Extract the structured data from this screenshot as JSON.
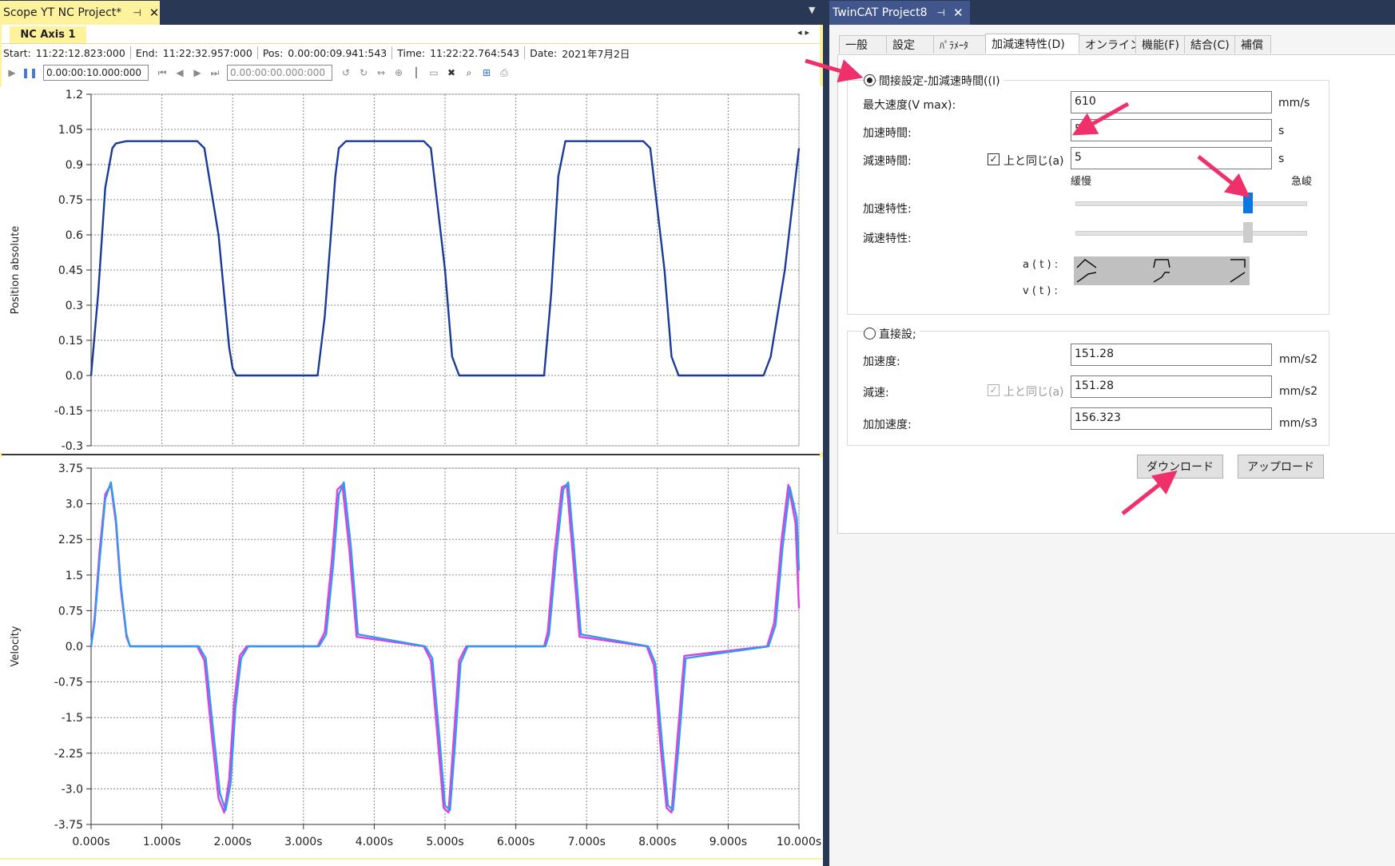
{
  "scope": {
    "tab_title": "Scope YT NC Project*",
    "pin_icon": "pin-icon",
    "close_icon": "close-icon",
    "axis_tab": "NC  Axis 1",
    "info": {
      "start_label": "Start:",
      "start_value": "11:22:12.823:000",
      "end_label": "End:",
      "end_value": "11:22:32.957:000",
      "pos_label": "Pos:",
      "pos_value": "0.00:00:09.941:543",
      "time_label": "Time:",
      "time_value": "11:22:22.764:543",
      "date_label": "Date:",
      "date_value": "2021年7月2日"
    },
    "toolbar": {
      "duration_value": "0.00:00:10.000:000",
      "offset_value": "0.00:00:00.000:000"
    }
  },
  "chart_data": [
    {
      "type": "line",
      "name": "position-chart",
      "ylabel": "Position absolute",
      "xlabel": "",
      "xlim": [
        0,
        10
      ],
      "ylim": [
        -0.3,
        1.2
      ],
      "y_ticks": [
        "1.2",
        "1.05",
        "0.9",
        "0.75",
        "0.6",
        "0.45",
        "0.3",
        "0.15",
        "0.0",
        "-0.15",
        "-0.3"
      ],
      "y_tick_values": [
        1.2,
        1.05,
        0.9,
        0.75,
        0.6,
        0.45,
        0.3,
        0.15,
        0.0,
        -0.15,
        -0.3
      ],
      "grid": true,
      "series": [
        {
          "color": "#1a3a9a",
          "x": [
            0.0,
            0.1,
            0.2,
            0.3,
            0.35,
            0.5,
            1.5,
            1.6,
            1.8,
            1.95,
            2.0,
            2.05,
            2.2,
            3.2,
            3.3,
            3.45,
            3.5,
            3.6,
            4.7,
            4.8,
            5.0,
            5.1,
            5.2,
            6.4,
            6.5,
            6.6,
            6.7,
            7.8,
            7.9,
            8.1,
            8.2,
            8.3,
            9.5,
            9.6,
            9.8,
            10.0
          ],
          "y": [
            0.0,
            0.35,
            0.8,
            0.97,
            0.99,
            1.0,
            1.0,
            0.97,
            0.6,
            0.12,
            0.03,
            0.0,
            0.0,
            0.0,
            0.25,
            0.85,
            0.97,
            1.0,
            1.0,
            0.97,
            0.45,
            0.08,
            0.0,
            0.0,
            0.35,
            0.85,
            1.0,
            1.0,
            0.97,
            0.45,
            0.08,
            0.0,
            0.0,
            0.08,
            0.45,
            0.97
          ]
        }
      ]
    },
    {
      "type": "line",
      "name": "velocity-chart",
      "ylabel": "Velocity",
      "xlabel": "",
      "x_ticks": [
        "0.000s",
        "1.000s",
        "2.000s",
        "3.000s",
        "4.000s",
        "5.000s",
        "6.000s",
        "7.000s",
        "8.000s",
        "9.000s",
        "10.000s"
      ],
      "x_tick_values": [
        0,
        1,
        2,
        3,
        4,
        5,
        6,
        7,
        8,
        9,
        10
      ],
      "xlim": [
        0,
        10
      ],
      "ylim": [
        -3.75,
        3.75
      ],
      "y_ticks": [
        "3.75",
        "3.0",
        "2.25",
        "1.5",
        "0.75",
        "0.0",
        "-0.75",
        "-1.5",
        "-2.25",
        "-3.0",
        "-3.75"
      ],
      "y_tick_values": [
        3.75,
        3.0,
        2.25,
        1.5,
        0.75,
        0.0,
        -0.75,
        -1.5,
        -2.25,
        -3.0,
        -3.75
      ],
      "grid": true,
      "series": [
        {
          "color": "#e040e0",
          "x": [
            0.0,
            0.05,
            0.12,
            0.2,
            0.28,
            0.35,
            0.42,
            0.5,
            0.55,
            1.5,
            1.6,
            1.7,
            1.8,
            1.88,
            1.95,
            2.02,
            2.1,
            2.2,
            3.2,
            3.3,
            3.4,
            3.48,
            3.55,
            3.65,
            3.75,
            4.7,
            4.8,
            4.9,
            4.98,
            5.05,
            5.12,
            5.2,
            5.3,
            6.4,
            6.45,
            6.55,
            6.65,
            6.72,
            6.8,
            6.9,
            7.85,
            7.95,
            8.05,
            8.13,
            8.2,
            8.28,
            8.38,
            9.55,
            9.65,
            9.75,
            9.85,
            9.95,
            10.0
          ],
          "y": [
            0.0,
            0.6,
            2.0,
            3.2,
            3.4,
            2.6,
            1.2,
            0.2,
            0.0,
            0.0,
            -0.3,
            -1.8,
            -3.2,
            -3.5,
            -2.8,
            -1.2,
            -0.2,
            0.0,
            0.0,
            0.3,
            1.8,
            3.3,
            3.4,
            2.0,
            0.2,
            0.0,
            -0.3,
            -2.0,
            -3.4,
            -3.5,
            -2.0,
            -0.3,
            0.0,
            0.0,
            0.3,
            2.0,
            3.35,
            3.4,
            2.0,
            0.2,
            0.0,
            -0.4,
            -2.2,
            -3.4,
            -3.5,
            -2.0,
            -0.2,
            0.0,
            0.5,
            2.2,
            3.4,
            2.6,
            0.8
          ]
        },
        {
          "color": "#3399ee",
          "x": [
            0.0,
            0.05,
            0.12,
            0.2,
            0.28,
            0.35,
            0.42,
            0.5,
            0.55,
            1.52,
            1.62,
            1.72,
            1.82,
            1.9,
            1.97,
            2.04,
            2.12,
            2.22,
            3.22,
            3.32,
            3.42,
            3.5,
            3.57,
            3.67,
            3.77,
            4.72,
            4.82,
            4.92,
            5.0,
            5.07,
            5.14,
            5.22,
            5.32,
            6.42,
            6.47,
            6.57,
            6.67,
            6.74,
            6.82,
            6.92,
            7.87,
            7.97,
            8.07,
            8.15,
            8.22,
            8.3,
            8.4,
            9.57,
            9.67,
            9.77,
            9.87,
            9.97,
            10.0
          ],
          "y": [
            0.0,
            0.5,
            1.8,
            3.1,
            3.45,
            2.7,
            1.3,
            0.25,
            0.0,
            0.0,
            -0.25,
            -1.7,
            -3.1,
            -3.45,
            -2.9,
            -1.3,
            -0.25,
            0.0,
            0.0,
            0.25,
            1.7,
            3.2,
            3.45,
            2.1,
            0.25,
            0.0,
            -0.25,
            -1.9,
            -3.35,
            -3.45,
            -2.1,
            -0.35,
            0.0,
            0.0,
            0.25,
            1.9,
            3.3,
            3.45,
            2.1,
            0.25,
            0.0,
            -0.35,
            -2.1,
            -3.35,
            -3.45,
            -2.1,
            -0.25,
            0.0,
            0.45,
            2.1,
            3.35,
            2.7,
            1.6
          ]
        }
      ]
    }
  ],
  "settings": {
    "tab_title": "TwinCAT Project8",
    "tabs": [
      "一般",
      "設定",
      "ﾊﾟﾗﾒｰﾀ",
      "加減速特性(D)",
      "オンライン",
      "機能(F)",
      "結合(C)",
      "補償"
    ],
    "indirect": {
      "label": "間接設定-加減速時間((I)",
      "vmax_label": "最大速度(V max):",
      "vmax_value": "610",
      "vmax_unit": "mm/s",
      "acc_time_label": "加速時間:",
      "acc_time_value": "5",
      "acc_time_unit": "s",
      "dec_time_label": "減速時間:",
      "same_label": "上と同じ(a)",
      "dec_time_value": "5",
      "dec_time_unit": "s",
      "slow_label": "緩慢",
      "steep_label": "急峻",
      "acc_char_label": "加速特性:",
      "dec_char_label": "減速特性:",
      "acc_char_level": 0.75,
      "dec_char_level": 0.75,
      "at_label": "a ( t ) :",
      "vt_label": "v ( t ) :"
    },
    "direct": {
      "label": "直接設;",
      "acc_label": "加速度:",
      "acc_value": "151.28",
      "acc_unit": "mm/s2",
      "dec_label": "減速:",
      "same_label": "上と同じ(a)",
      "dec_value": "151.28",
      "dec_unit": "mm/s2",
      "jerk_label": "加加速度:",
      "jerk_value": "156.323",
      "jerk_unit": "mm/s3"
    },
    "download_label": "ダウンロード",
    "upload_label": "アップロード"
  }
}
